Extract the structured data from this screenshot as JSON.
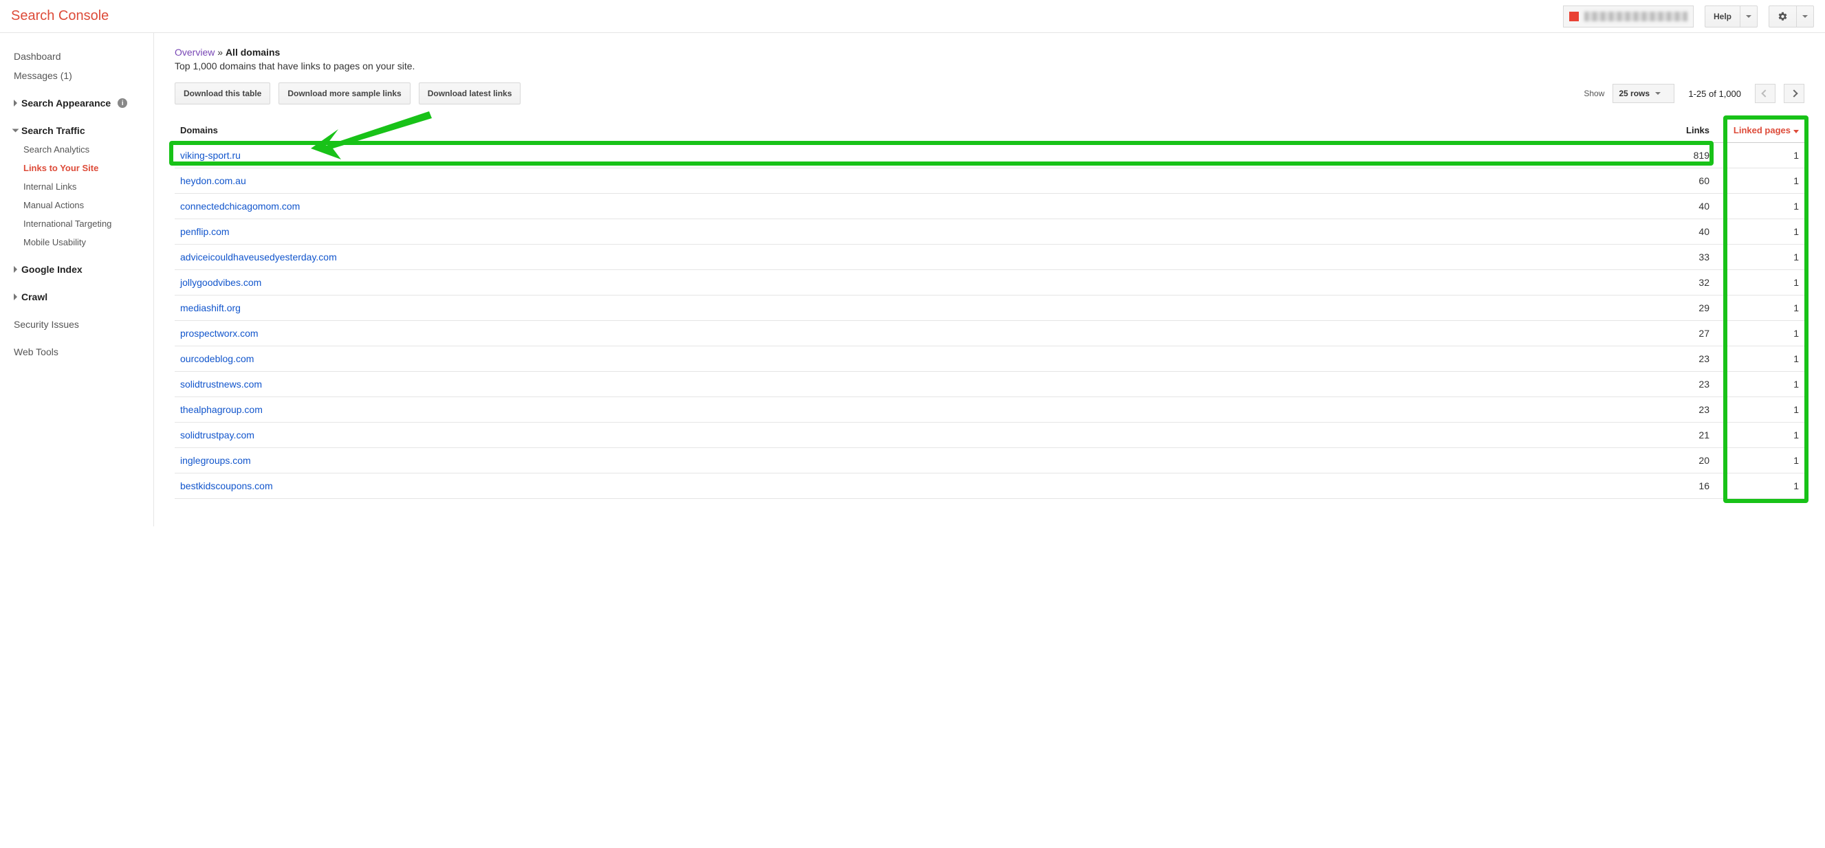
{
  "header": {
    "app_title": "Search Console",
    "help_label": "Help"
  },
  "sidebar": {
    "dashboard": "Dashboard",
    "messages": "Messages (1)",
    "search_appearance": "Search Appearance",
    "search_traffic": "Search Traffic",
    "search_analytics": "Search Analytics",
    "links_to_your_site": "Links to Your Site",
    "internal_links": "Internal Links",
    "manual_actions": "Manual Actions",
    "international_targeting": "International Targeting",
    "mobile_usability": "Mobile Usability",
    "google_index": "Google Index",
    "crawl": "Crawl",
    "security_issues": "Security Issues",
    "web_tools": "Web Tools"
  },
  "main": {
    "breadcrumb_overview": "Overview",
    "breadcrumb_sep": " » ",
    "breadcrumb_current": "All domains",
    "subtitle": "Top 1,000 domains that have links to pages on your site.",
    "download_table": "Download this table",
    "download_more": "Download more sample links",
    "download_latest": "Download latest links",
    "show_label": "Show",
    "rows_value": "25 rows",
    "page_info": "1-25 of 1,000",
    "col_domain": "Domains",
    "col_links": "Links",
    "col_linked_pages": "Linked pages",
    "rows": [
      {
        "domain": "viking-sport.ru",
        "links": "819",
        "linked": "1"
      },
      {
        "domain": "heydon.com.au",
        "links": "60",
        "linked": "1"
      },
      {
        "domain": "connectedchicagomom.com",
        "links": "40",
        "linked": "1"
      },
      {
        "domain": "penflip.com",
        "links": "40",
        "linked": "1"
      },
      {
        "domain": "adviceicouldhaveusedyesterday.com",
        "links": "33",
        "linked": "1"
      },
      {
        "domain": "jollygoodvibes.com",
        "links": "32",
        "linked": "1"
      },
      {
        "domain": "mediashift.org",
        "links": "29",
        "linked": "1"
      },
      {
        "domain": "prospectworx.com",
        "links": "27",
        "linked": "1"
      },
      {
        "domain": "ourcodeblog.com",
        "links": "23",
        "linked": "1"
      },
      {
        "domain": "solidtrustnews.com",
        "links": "23",
        "linked": "1"
      },
      {
        "domain": "thealphagroup.com",
        "links": "23",
        "linked": "1"
      },
      {
        "domain": "solidtrustpay.com",
        "links": "21",
        "linked": "1"
      },
      {
        "domain": "inglegroups.com",
        "links": "20",
        "linked": "1"
      },
      {
        "domain": "bestkidscoupons.com",
        "links": "16",
        "linked": "1"
      }
    ]
  }
}
